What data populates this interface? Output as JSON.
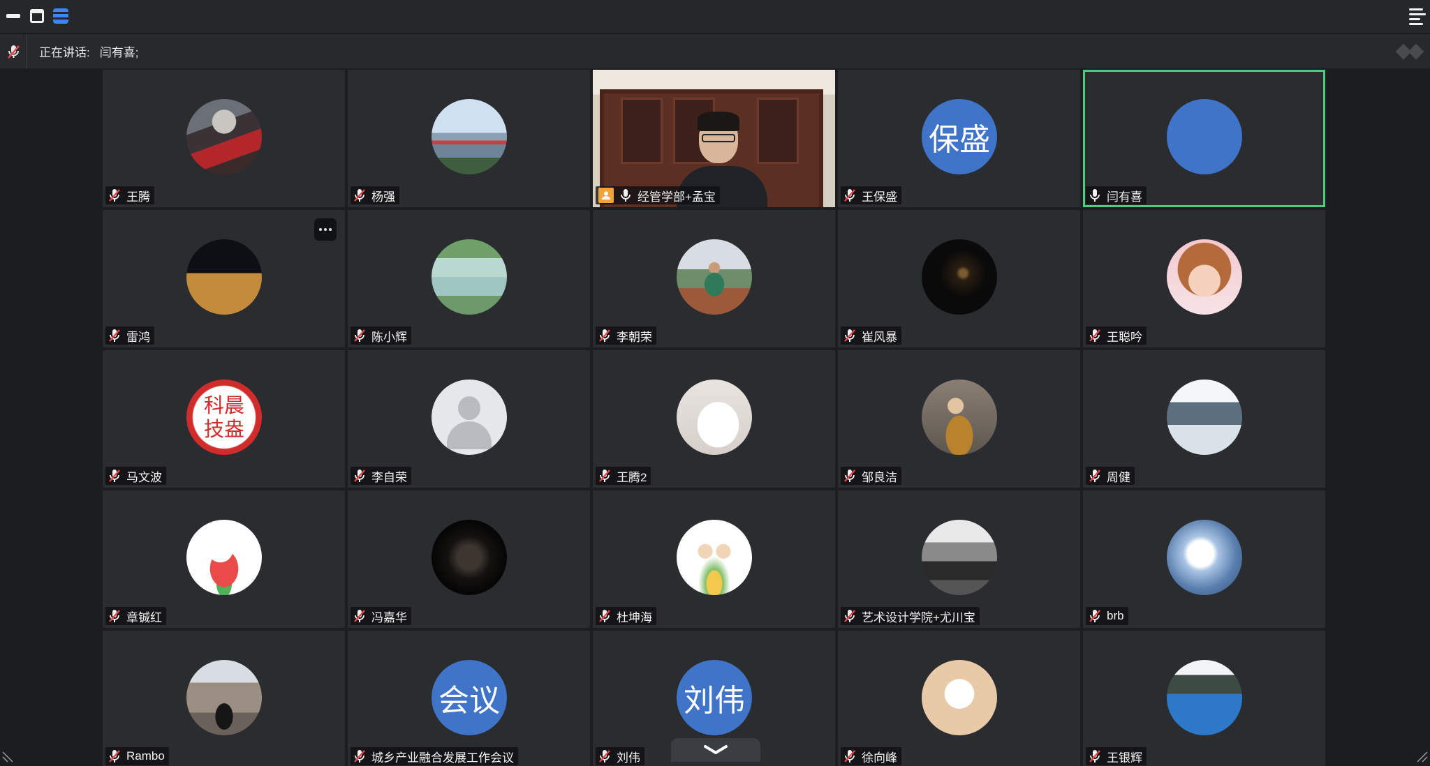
{
  "speaking": {
    "label": "正在讲话:",
    "names": "闫有喜;"
  },
  "participants": [
    {
      "name": "王腾",
      "avatar": "photo-city-night-street",
      "muted": true
    },
    {
      "name": "杨强",
      "avatar": "photo-city-bridge",
      "muted": true
    },
    {
      "name": "经管学部+孟宝",
      "avatar": "video",
      "muted": false,
      "host": true
    },
    {
      "name": "王保盛",
      "avatar": "text",
      "avatar_text": "保盛",
      "muted": true
    },
    {
      "name": "闫有喜",
      "avatar": "plain-blue",
      "muted": false,
      "speaking": true
    },
    {
      "name": "雷鸿",
      "avatar": "photo-beach-night",
      "muted": true,
      "more_menu": true
    },
    {
      "name": "陈小辉",
      "avatar": "photo-lake-reflection",
      "muted": true
    },
    {
      "name": "李朝荣",
      "avatar": "photo-man-outdoors",
      "muted": true
    },
    {
      "name": "崔风暴",
      "avatar": "photo-dark-sparkle",
      "muted": true
    },
    {
      "name": "王聪吟",
      "avatar": "photo-girl-portrait",
      "muted": true
    },
    {
      "name": "马文波",
      "avatar": "photo-red-seal",
      "muted": true,
      "avatar_text": "科晨技盎"
    },
    {
      "name": "李自荣",
      "avatar": "placeholder",
      "muted": true
    },
    {
      "name": "王腾2",
      "avatar": "photo-white-hood-illustration",
      "muted": true
    },
    {
      "name": "邹良洁",
      "avatar": "photo-child-toy",
      "muted": true
    },
    {
      "name": "周健",
      "avatar": "photo-snow-trees",
      "muted": true
    },
    {
      "name": "章铖红",
      "avatar": "photo-cartoon-pig",
      "muted": true
    },
    {
      "name": "冯嘉华",
      "avatar": "photo-dark-portrait",
      "muted": true
    },
    {
      "name": "杜坤海",
      "avatar": "photo-cartoon-couple",
      "muted": true
    },
    {
      "name": "艺术设计学院+尤川宝",
      "avatar": "photo-monochrome-landscape",
      "muted": true
    },
    {
      "name": "brb",
      "avatar": "photo-ink-figure",
      "muted": true
    },
    {
      "name": "Rambo",
      "avatar": "photo-street-woman",
      "muted": true
    },
    {
      "name": "城乡产业融合发展工作会议",
      "avatar": "text",
      "avatar_text": "会议",
      "muted": true
    },
    {
      "name": "刘伟",
      "avatar": "text",
      "avatar_text": "刘伟",
      "muted": true
    },
    {
      "name": "徐向峰",
      "avatar": "photo-lucky-cat",
      "muted": true
    },
    {
      "name": "王银辉",
      "avatar": "photo-mountain-lake",
      "muted": true
    }
  ],
  "colors": {
    "avatar_blue": "#3f74c8",
    "active_border": "#4fc97f",
    "tile_bg": "#2a2c30",
    "host_badge": "#f0a336",
    "muted_red": "#e5484d"
  }
}
